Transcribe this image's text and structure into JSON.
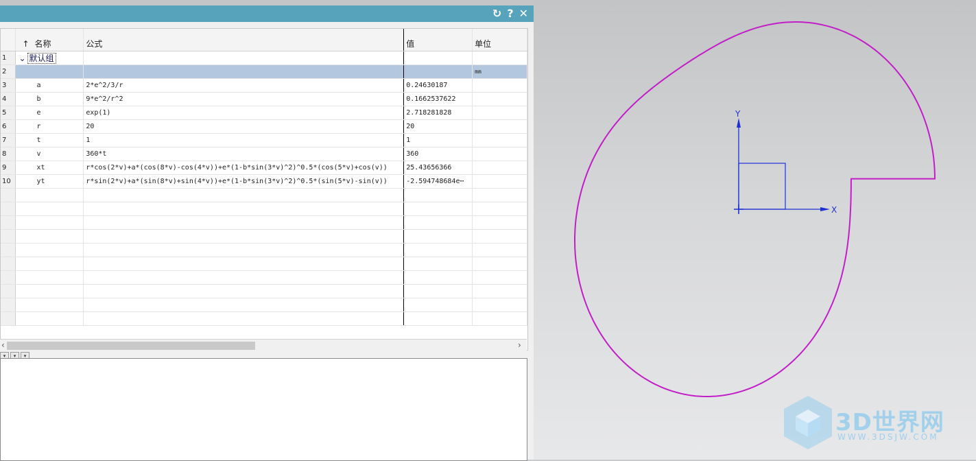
{
  "dialog": {
    "icons": [
      "refresh-icon",
      "help-icon",
      "close-icon"
    ],
    "help_label": "?",
    "close_label": "✕",
    "refresh_label": "↻"
  },
  "table": {
    "sort_indicator": "↑",
    "headers": {
      "name": "名称",
      "formula": "公式",
      "value": "值",
      "unit": "单位"
    },
    "group": {
      "row": "1",
      "label": "默认组",
      "expand": "⌄"
    },
    "rows": [
      {
        "row": "2",
        "name": "",
        "formula": "",
        "value": "",
        "unit": "mm"
      },
      {
        "row": "3",
        "name": "a",
        "formula": "2*e^2/3/r",
        "value": "0.24630187",
        "unit": ""
      },
      {
        "row": "4",
        "name": "b",
        "formula": "9*e^2/r^2",
        "value": "0.1662537622",
        "unit": ""
      },
      {
        "row": "5",
        "name": "e",
        "formula": "exp(1)",
        "value": "2.718281828",
        "unit": ""
      },
      {
        "row": "6",
        "name": "r",
        "formula": "20",
        "value": "20",
        "unit": ""
      },
      {
        "row": "7",
        "name": "t",
        "formula": "1",
        "value": "1",
        "unit": ""
      },
      {
        "row": "8",
        "name": "v",
        "formula": "360*t",
        "value": "360",
        "unit": ""
      },
      {
        "row": "9",
        "name": "xt",
        "formula": "r*cos(2*v)+a*(cos(8*v)-cos(4*v))+e*(1-b*sin(3*v)^2)^0.5*(cos(5*v)+cos(v))",
        "value": "25.43656366",
        "unit": ""
      },
      {
        "row": "10",
        "name": "yt",
        "formula": "r*sin(2*v)+a*(sin(8*v)+sin(4*v))+e*(1-b*sin(3*v)^2)^0.5*(sin(5*v)-sin(v))",
        "value": "-2.594748684e⋯",
        "unit": ""
      }
    ],
    "scroll_left": "‹",
    "scroll_right": "›"
  },
  "dropdowns": [
    "▾",
    "▾",
    "▾"
  ],
  "viewport": {
    "axis_x_label": "X",
    "axis_y_label": "Y",
    "curve_color": "#c21ec8",
    "axis_color": "#1f2fd6"
  },
  "watermark": {
    "title": "3D世界网",
    "url": "WWW.3DSJW.COM"
  }
}
